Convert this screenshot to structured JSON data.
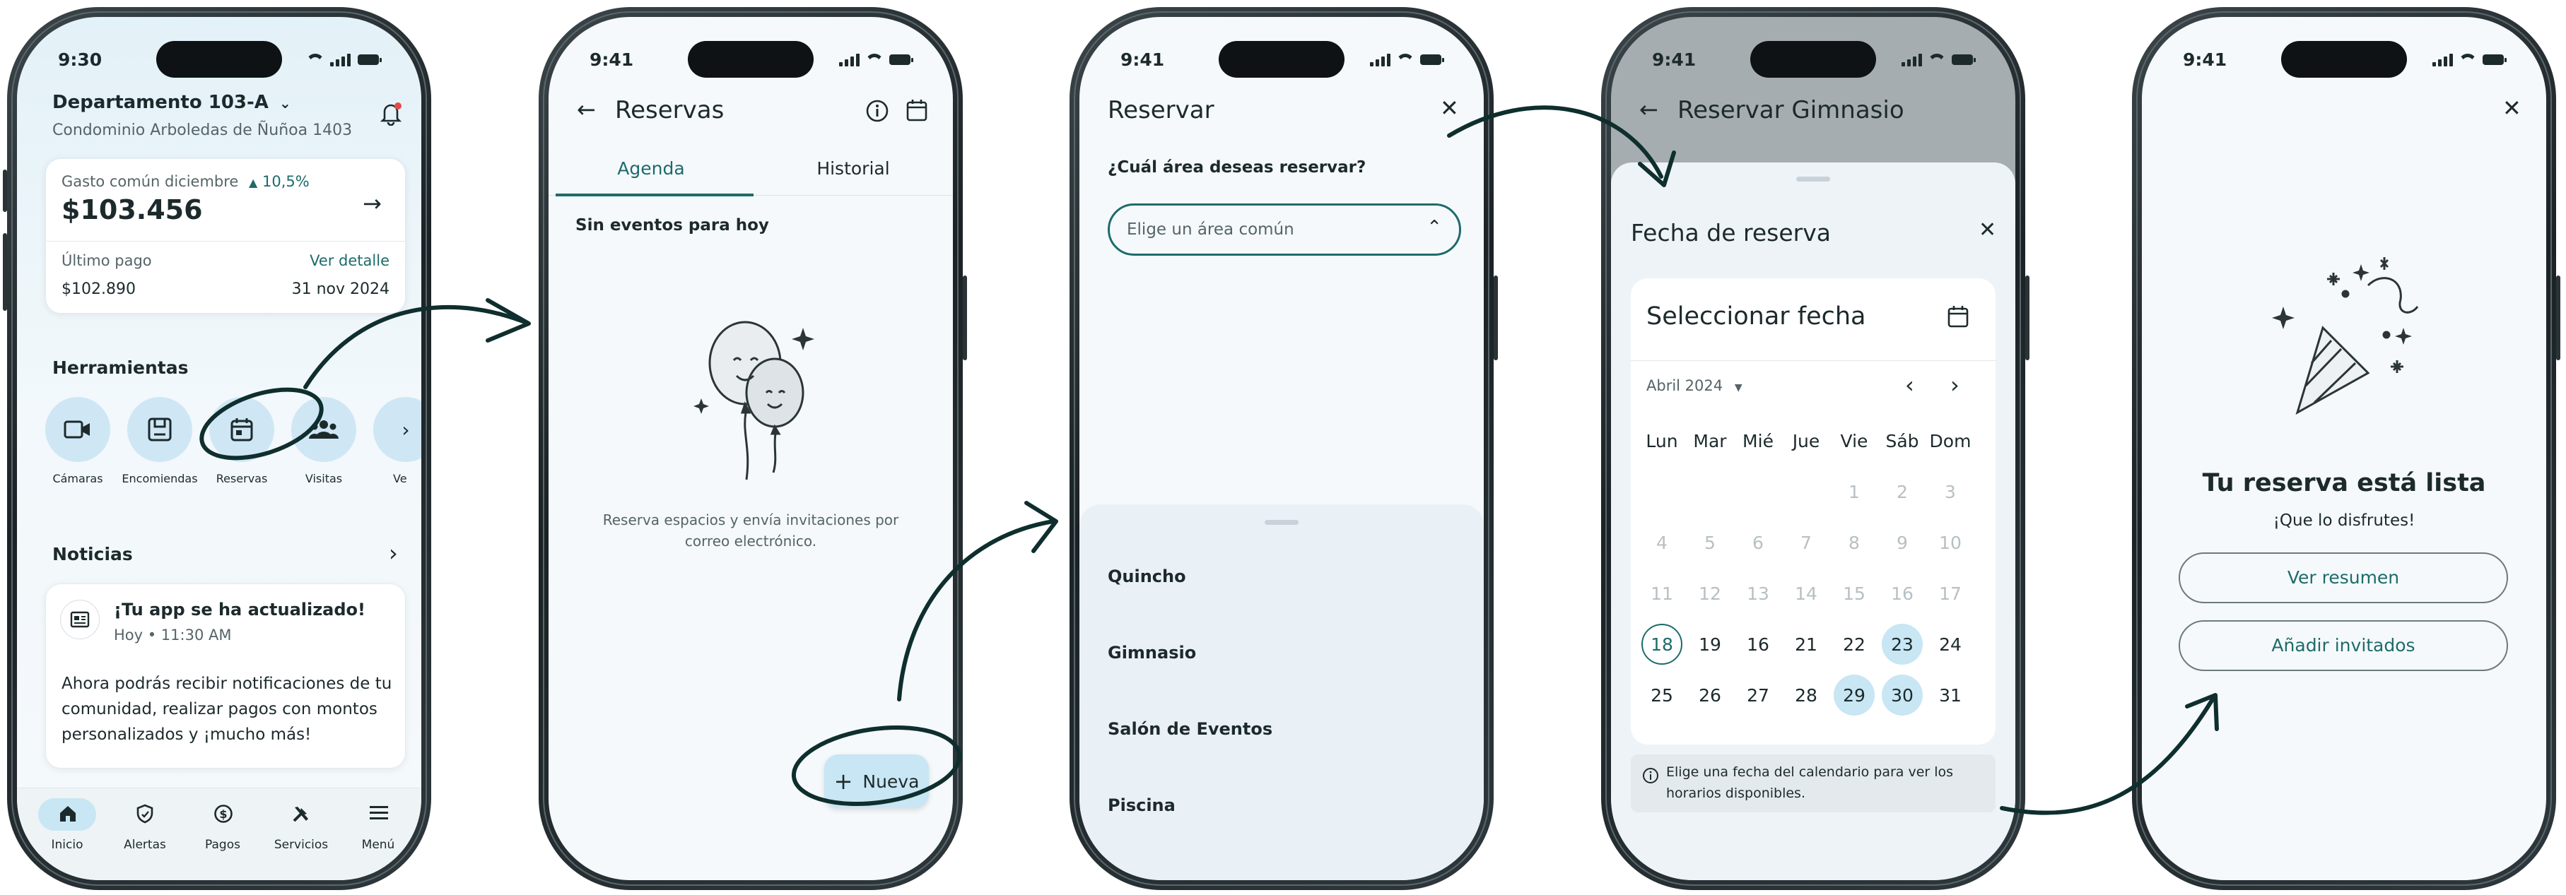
{
  "colors": {
    "accent": "#1e6b6b",
    "chip": "#cfe7f4",
    "screen_bg": "#f5f9fc",
    "arrow": "#0f2e2e"
  },
  "phone1": {
    "time": "9:30",
    "unit": "Departamento 103-A",
    "address": "Condominio Arboledas de Ñuñoa 1403",
    "gasto_label": "Gasto común diciembre",
    "gasto_change": "10,5%",
    "gasto_amount": "$103.456",
    "ultimo_pago_label": "Último pago",
    "ver_detalle": "Ver detalle",
    "ultimo_pago_amount": "$102.890",
    "ultimo_pago_date": "31 nov 2024",
    "herramientas": "Herramientas",
    "tools": [
      "Cámaras",
      "Encomiendas",
      "Reservas",
      "Visitas",
      "Ve"
    ],
    "noticias": "Noticias",
    "news_title": "¡Tu app se ha actualizado!",
    "news_time": "Hoy • 11:30 AM",
    "news_body_1": "Ahora podrás recibir notificaciones de tu",
    "news_body_2": "comunidad, realizar pagos con montos",
    "news_body_3": "personalizados y ¡mucho más!",
    "nav": [
      "Inicio",
      "Alertas",
      "Pagos",
      "Servicios",
      "Menú"
    ]
  },
  "phone2": {
    "time": "9:41",
    "title": "Reservas",
    "tabs": [
      "Agenda",
      "Historial"
    ],
    "empty_heading": "Sin eventos para hoy",
    "empty_line1": "Reserva espacios y envía invitaciones por",
    "empty_line2": "correo electrónico.",
    "fab_label": "Nueva"
  },
  "phone3": {
    "time": "9:41",
    "title": "Reservar",
    "question": "¿Cuál área deseas reservar?",
    "select_placeholder": "Elige un área común",
    "options": [
      "Quincho",
      "Gimnasio",
      "Salón de Eventos",
      "Piscina"
    ]
  },
  "phone4": {
    "time": "9:41",
    "title": "Reservar Gimnasio",
    "sheet_title": "Fecha de reserva",
    "picker_title": "Seleccionar fecha",
    "month": "Abril 2024",
    "weekdays": [
      "Lun",
      "Mar",
      "Mié",
      "Jue",
      "Vie",
      "Sáb",
      "Dom"
    ],
    "weeks": [
      [
        "",
        "",
        "",
        "",
        "1",
        "2",
        "3"
      ],
      [
        "4",
        "5",
        "6",
        "7",
        "8",
        "9",
        "10"
      ],
      [
        "11",
        "12",
        "13",
        "14",
        "15",
        "16",
        "17"
      ],
      [
        "18",
        "19",
        "16",
        "21",
        "22",
        "23",
        "24"
      ],
      [
        "25",
        "26",
        "27",
        "28",
        "29",
        "30",
        "31"
      ]
    ],
    "info_line1": "Elige una fecha del calendario para ver los",
    "info_line2": "horarios disponibles."
  },
  "phone5": {
    "time": "9:41",
    "title": "Tu reserva está lista",
    "subtitle": "¡Que lo disfrutes!",
    "btn_resumen": "Ver resumen",
    "btn_invitados": "Añadir invitados"
  }
}
